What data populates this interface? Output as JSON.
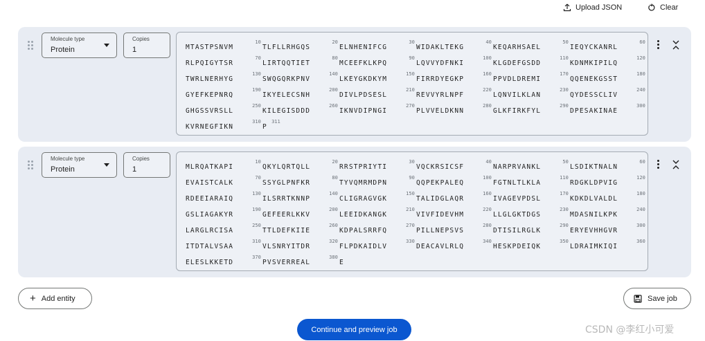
{
  "header": {
    "upload_label": "Upload JSON",
    "clear_label": "Clear"
  },
  "entities": [
    {
      "molecule_type_label": "Molecule type",
      "molecule_type_value": "Protein",
      "copies_label": "Copies",
      "copies_value": "1",
      "sequence": "MTASTPSNVMTLFLLRHGQSELNHENIFCGWIDAKLTEKGKEQARHSAELIEQYCKANRLRLPQIGYTSRLIRTQQTIETMCEEFKLKPQLQVVYDFNKIKLGDEFGSDDKDNMKIPILQTWRLNERHYGSWQGQRKPNVLKEYGKDKYMFIRRDYEGKPPPVDLDREMIQQENEKGSSTGYEFKEPNRQIKYELECSNHDIVLPDSESLREVVYRLNPFLQNVILKLANQYDESSCLIVGHGSSVRSLLKILEGISDDDIKNVDIPNGIPLVVELDKNNGLKFIRKFYLDPESAKINAEKVRNEGFIKNP",
      "length_label": "311"
    },
    {
      "molecule_type_label": "Molecule type",
      "molecule_type_value": "Protein",
      "copies_label": "Copies",
      "copies_value": "1",
      "sequence": "MLRQATKAPIQKYLQRTQLLRRSTPRIYTIVQCKRSICSFNARPRVANKLLSDIKTNALNEVAISTCALKSSYGLPNFKRTYVQMRMDPNQQPEKPALEQFGTNLTLKLARDGKLDPVIGRDEEIARAIQILSRRTKNNPCLIGRAGVGKTALIDGLAQRIVAGEVPDSLKDKDLVALDLGSLIAGAKYRGEFEERLKKVLEEIDKANGKVIVFIDEVHMLLGLGKTDGSMDASNILKPKLARGLRCISATTLDEFKIIEKDPALSRRFQPILLNEPSVSDTISILRGLKERYEVHHGVRITDTALVSAAVLSNRYITDRFLPDKAIDLVDEACAVLRLQHESKPDEIQKLDRAIMKIQIELESLKKETDPVSVERREALE",
      "length_label": ""
    }
  ],
  "actions": {
    "add_entity_label": "Add entity",
    "save_job_label": "Save job",
    "continue_label": "Continue and preview job"
  },
  "watermark": "CSDN @李红小可爱",
  "colors": {
    "primary": "#0b57d0",
    "entity_bg": "#e8ecf3",
    "text": "#1f1f1f"
  }
}
